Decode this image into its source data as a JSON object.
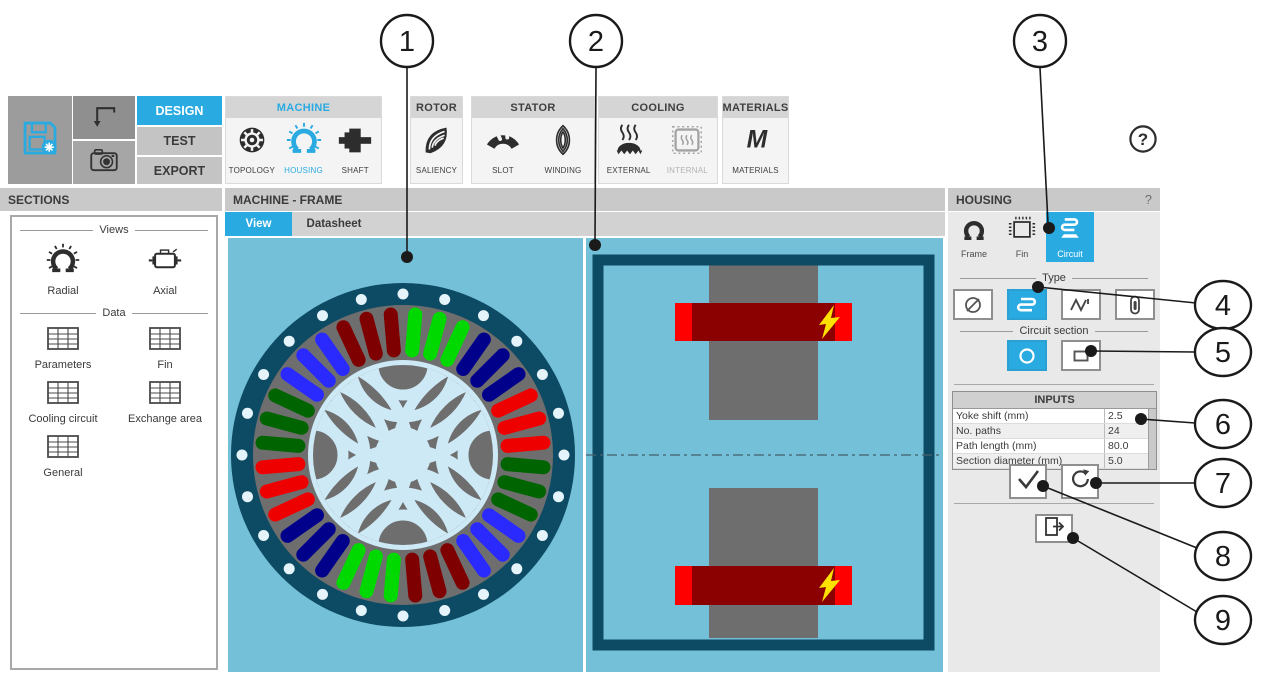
{
  "ribbon": {
    "mode_tabs": [
      {
        "label": "DESIGN",
        "active": true
      },
      {
        "label": "TEST",
        "active": false
      },
      {
        "label": "EXPORT",
        "active": false
      }
    ],
    "groups": {
      "machine": {
        "label": "MACHINE",
        "items": [
          {
            "label": "TOPOLOGY"
          },
          {
            "label": "HOUSING",
            "active": true
          },
          {
            "label": "SHAFT"
          }
        ]
      },
      "rotor": {
        "label": "ROTOR",
        "items": [
          {
            "label": "SALIENCY"
          }
        ]
      },
      "stator": {
        "label": "STATOR",
        "items": [
          {
            "label": "SLOT"
          },
          {
            "label": "WINDING"
          }
        ]
      },
      "cooling": {
        "label": "COOLING",
        "items": [
          {
            "label": "EXTERNAL"
          },
          {
            "label": "INTERNAL",
            "disabled": true
          }
        ]
      },
      "materials": {
        "label": "MATERIALS",
        "items": [
          {
            "label": "MATERIALS"
          }
        ]
      }
    },
    "help_glyph": "?"
  },
  "sections_panel": {
    "title": "SECTIONS",
    "views_legend": "Views",
    "views": [
      {
        "label": "Radial"
      },
      {
        "label": "Axial"
      }
    ],
    "data_legend": "Data",
    "data_items": [
      {
        "label": "Parameters"
      },
      {
        "label": "Fin"
      },
      {
        "label": "Cooling circuit"
      },
      {
        "label": "Exchange area"
      },
      {
        "label": "General"
      }
    ]
  },
  "main": {
    "title": "MACHINE - FRAME",
    "tabs": [
      {
        "label": "View",
        "active": true
      },
      {
        "label": "Datasheet",
        "active": false
      }
    ]
  },
  "housing_panel": {
    "title": "HOUSING",
    "help_glyph": "?",
    "tabs": [
      {
        "label": "Frame",
        "active": false
      },
      {
        "label": "Fin",
        "active": false
      },
      {
        "label": "Circuit",
        "active": true
      }
    ],
    "type_legend": "Type",
    "circuit_section_legend": "Circuit section",
    "inputs": {
      "title": "INPUTS",
      "rows": [
        {
          "label": "Yoke shift (mm)",
          "value": "2.5"
        },
        {
          "label": "No. paths",
          "value": "24"
        },
        {
          "label": "Path length (mm)",
          "value": "80.0"
        },
        {
          "label": "Section diameter (mm)",
          "value": "5.0"
        }
      ]
    }
  },
  "icons": {
    "materials_glyph": "M",
    "question_glyph": "?"
  },
  "callouts": {
    "labels": [
      "1",
      "2",
      "3",
      "4",
      "5",
      "6",
      "7",
      "8",
      "9"
    ]
  },
  "colors": {
    "accent": "#29abe2",
    "canvas_blue": "#74c0d8",
    "housing_teal": "#0d4a63",
    "stator_gray": "#6e6e6e",
    "rotor_light": "#cde9f5",
    "bolt_dot": "#e4f4fa",
    "winding_dark_red": "#8b0000",
    "winding_bright_red": "#ff0000",
    "bolt_yellow": "#ffe100"
  },
  "radial_view": {
    "slot_count": 36,
    "band_size": 3,
    "phase_colors": [
      "#00d900",
      "#00008b",
      "#ee0000",
      "#006400",
      "#2a2aff",
      "#7f0000"
    ],
    "bolt_count": 24,
    "pole_count": 4,
    "barrier_radii": [
      30,
      52,
      74,
      96
    ]
  }
}
